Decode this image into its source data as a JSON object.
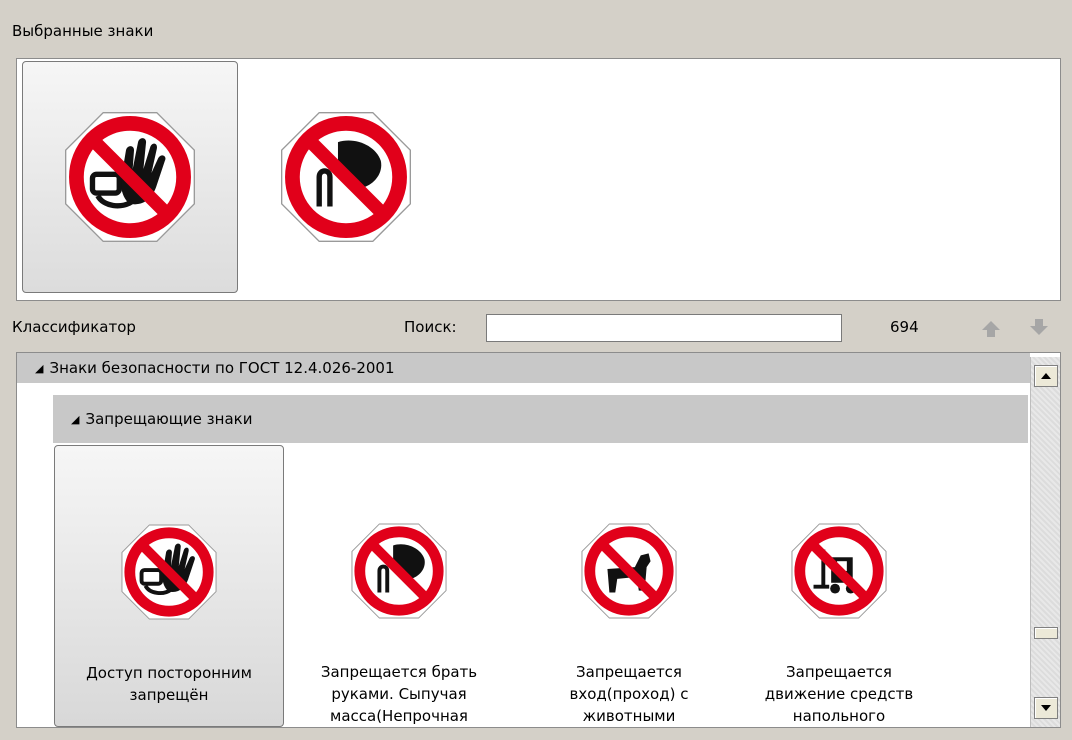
{
  "selected_signs": {
    "title": "Выбранные знаки",
    "items": [
      {
        "icon": "no-entry-hand-icon",
        "selected": true
      },
      {
        "icon": "no-touch-bulk-icon",
        "selected": false
      }
    ]
  },
  "classifier": {
    "title": "Классификатор",
    "search_label": "Поиск:",
    "search_value": "",
    "count": "694"
  },
  "tree": {
    "root_label": "Знаки безопасности по ГОСТ 12.4.026-2001",
    "group_label": "Запрещающие знаки",
    "items": [
      {
        "icon": "no-entry-hand-icon",
        "line1": "Доступ посторонним",
        "line2": "запрещён",
        "line3": "",
        "selected": true
      },
      {
        "icon": "no-touch-bulk-icon",
        "line1": "Запрещается брать",
        "line2": "руками. Сыпучая",
        "line3": "масса(Непрочная",
        "selected": false
      },
      {
        "icon": "no-animals-icon",
        "line1": "Запрещается",
        "line2": "вход(проход) с",
        "line3": "животными",
        "selected": false
      },
      {
        "icon": "no-forklift-icon",
        "line1": "Запрещается",
        "line2": "движение средств",
        "line3": "напольного",
        "selected": false
      }
    ]
  },
  "colors": {
    "sign_red": "#e1001a",
    "panel_bg": "#d4d0c8"
  }
}
